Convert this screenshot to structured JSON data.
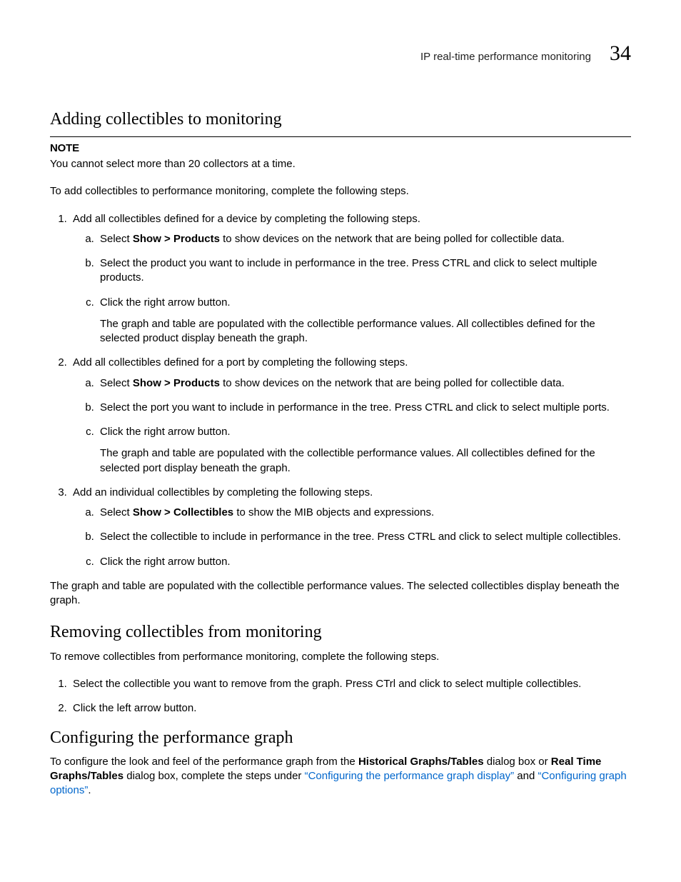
{
  "header": {
    "title": "IP real-time performance monitoring",
    "page_number": "34"
  },
  "sec1": {
    "heading": "Adding collectibles to monitoring",
    "note_label": "NOTE",
    "note_body": "You cannot select more than 20 collectors at a time.",
    "intro": "To add collectibles to performance monitoring, complete the following steps.",
    "steps": [
      {
        "text": "Add all collectibles defined for a device by completing the following steps.",
        "sub": [
          {
            "pre": "Select ",
            "bold": "Show > Products",
            "post": " to show devices on the network that are being polled for collectible data."
          },
          {
            "text": "Select the product you want to include in performance in the tree. Press CTRL and click to select multiple products."
          },
          {
            "text": "Click the right arrow button.",
            "extra": "The graph and table are populated with the collectible performance values. All collectibles defined for the selected product display beneath the graph."
          }
        ]
      },
      {
        "text": "Add all collectibles defined for a port by completing the following steps.",
        "sub": [
          {
            "pre": "Select ",
            "bold": "Show > Products",
            "post": " to show devices on the network that are being polled for collectible data."
          },
          {
            "text": "Select the port you want to include in performance in the tree. Press CTRL and click to select multiple ports."
          },
          {
            "text": "Click the right arrow button.",
            "extra": "The graph and table are populated with the collectible performance values. All collectibles defined for the selected port display beneath the graph."
          }
        ]
      },
      {
        "text": "Add an individual collectibles by completing the following steps.",
        "sub": [
          {
            "pre": "Select ",
            "bold": "Show > Collectibles",
            "post": " to show the MIB objects and expressions."
          },
          {
            "text": "Select the collectible to include in performance in the tree. Press CTRL and click to select multiple collectibles."
          },
          {
            "text": "Click the right arrow button."
          }
        ]
      }
    ],
    "tail": "The graph and table are populated with the collectible performance values. The selected collectibles display beneath the graph."
  },
  "sec2": {
    "heading": "Removing collectibles from monitoring",
    "intro": "To remove collectibles from performance monitoring, complete the following steps.",
    "steps": [
      "Select the collectible you want to remove from the graph. Press CTrl and click to select multiple collectibles.",
      "Click the left arrow button."
    ]
  },
  "sec3": {
    "heading": "Configuring the performance graph",
    "p1_a": "To configure the look and feel of the performance graph from the ",
    "p1_b": "Historical Graphs/Tables",
    "p1_c": " dialog box or ",
    "p1_d": "Real Time Graphs/Tables",
    "p1_e": " dialog box, complete the steps under ",
    "link1": "“Configuring the performance graph display”",
    "mid": " and ",
    "link2": "“Configuring graph options”",
    "end": "."
  }
}
